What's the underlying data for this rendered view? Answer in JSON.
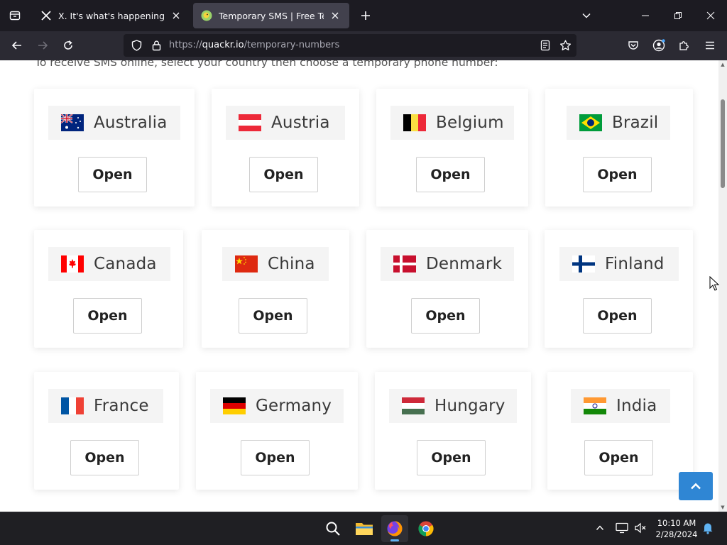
{
  "browser": {
    "tabs": [
      {
        "title": "X. It's what's happening / X",
        "favicon": "x-logo-icon",
        "active": false
      },
      {
        "title": "Temporary SMS | Free Temporary",
        "favicon": "quackr-favicon-icon",
        "active": true
      }
    ],
    "url": {
      "scheme": "https://",
      "host": "quackr.io",
      "path": "/temporary-numbers"
    }
  },
  "page": {
    "intro": "To receive SMS online, select your country then choose a temporary phone number:",
    "open_label": "Open",
    "countries": [
      {
        "name": "Australia",
        "flag": "australia-flag-icon"
      },
      {
        "name": "Austria",
        "flag": "austria-flag-icon"
      },
      {
        "name": "Belgium",
        "flag": "belgium-flag-icon"
      },
      {
        "name": "Brazil",
        "flag": "brazil-flag-icon"
      },
      {
        "name": "Canada",
        "flag": "canada-flag-icon"
      },
      {
        "name": "China",
        "flag": "china-flag-icon"
      },
      {
        "name": "Denmark",
        "flag": "denmark-flag-icon"
      },
      {
        "name": "Finland",
        "flag": "finland-flag-icon"
      },
      {
        "name": "France",
        "flag": "france-flag-icon"
      },
      {
        "name": "Germany",
        "flag": "germany-flag-icon"
      },
      {
        "name": "Hungary",
        "flag": "hungary-flag-icon"
      },
      {
        "name": "India",
        "flag": "india-flag-icon"
      }
    ]
  },
  "taskbar": {
    "apps": [
      "search-icon",
      "file-explorer-icon",
      "firefox-icon",
      "chrome-icon"
    ],
    "time": "10:10 AM",
    "date": "2/28/2024"
  },
  "colors": {
    "browser_frame": "#1c1b22",
    "toolbar": "#2b2a33",
    "active_tab": "#42414d",
    "back_to_top": "#2f86d4",
    "chip_bg": "#f4f4f4"
  }
}
